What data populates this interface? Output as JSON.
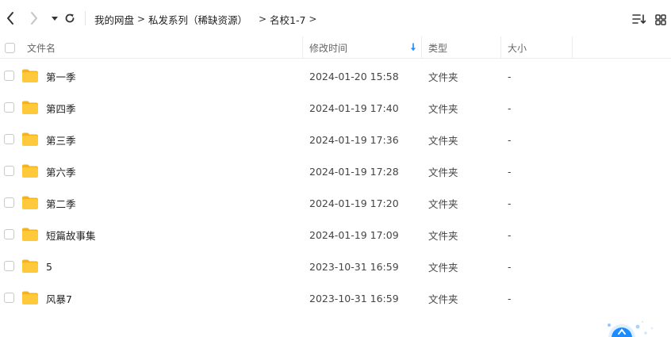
{
  "toolbar": {
    "back_icon": "chevron-left-icon",
    "forward_icon": "chevron-right-icon",
    "history_icon": "caret-down-icon",
    "refresh_icon": "refresh-icon",
    "sort_icon": "sort-list-icon",
    "grid_icon": "grid-view-icon"
  },
  "breadcrumb": {
    "items": [
      "我的网盘",
      "私发系列（稀缺资源）",
      "名校1-7"
    ],
    "separator": ">"
  },
  "table": {
    "columns": {
      "name": "文件名",
      "mtime": "修改时间",
      "type": "类型",
      "size": "大小"
    },
    "rows": [
      {
        "name": "第一季",
        "mtime": "2024-01-20 15:58",
        "type": "文件夹",
        "size": "-"
      },
      {
        "name": "第四季",
        "mtime": "2024-01-19 17:40",
        "type": "文件夹",
        "size": "-"
      },
      {
        "name": "第三季",
        "mtime": "2024-01-19 17:36",
        "type": "文件夹",
        "size": "-"
      },
      {
        "name": "第六季",
        "mtime": "2024-01-19 17:28",
        "type": "文件夹",
        "size": "-"
      },
      {
        "name": "第二季",
        "mtime": "2024-01-19 17:20",
        "type": "文件夹",
        "size": "-"
      },
      {
        "name": "短篇故事集",
        "mtime": "2024-01-19 17:09",
        "type": "文件夹",
        "size": "-"
      },
      {
        "name": "5",
        "mtime": "2023-10-31 16:59",
        "type": "文件夹",
        "size": "-"
      },
      {
        "name": "风暴7",
        "mtime": "2023-10-31 16:59",
        "type": "文件夹",
        "size": "-"
      }
    ]
  },
  "colors": {
    "accent": "#1a8cff",
    "folder_body": "#ffc93c",
    "folder_tab": "#f5b21a",
    "text": "#222222",
    "muted": "#666666"
  }
}
